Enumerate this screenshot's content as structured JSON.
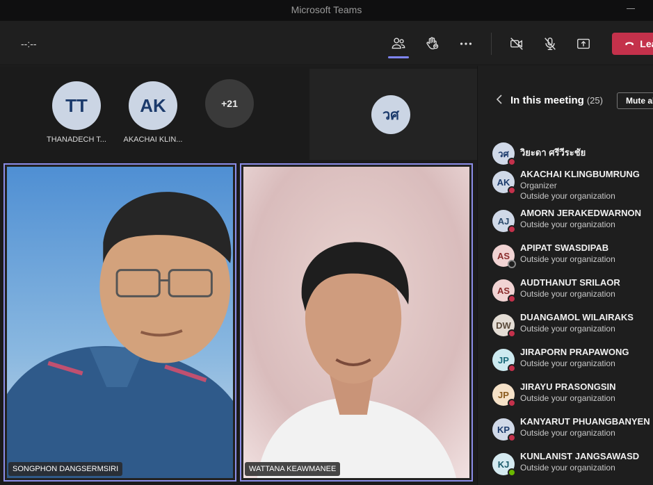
{
  "window": {
    "title": "Microsoft Teams"
  },
  "toolbar": {
    "timer": "--:--",
    "leave_label": "Leave",
    "icons": [
      "people-icon",
      "raise-hand-icon",
      "more-icon",
      "camera-off-icon",
      "mic-off-icon",
      "share-icon",
      "phone-icon"
    ]
  },
  "strip": {
    "avatars": [
      {
        "initials": "TT",
        "name": "THANADECH T..."
      },
      {
        "initials": "AK",
        "name": "AKACHAI KLIN..."
      }
    ],
    "more_count": "+21",
    "pinned_initials": "วศ"
  },
  "videos": [
    {
      "name": "SONGPHON DANGSERMSIRI"
    },
    {
      "name": "WATTANA KEAWMANEE"
    }
  ],
  "panel": {
    "title": "In this meeting",
    "count": "(25)",
    "mute_all_label": "Mute all",
    "participants": [
      {
        "initials": "วศ",
        "name": "วิยะดา ศรีวีระชัย",
        "subs": [],
        "status": "muted",
        "bg": "#d0d9e8",
        "fg": "#1b3a6b"
      },
      {
        "initials": "AK",
        "name": "AKACHAI KLINGBUMRUNG",
        "subs": [
          "Organizer",
          "Outside your organization"
        ],
        "status": "muted",
        "bg": "#d0d9e8",
        "fg": "#1b3a6b"
      },
      {
        "initials": "AJ",
        "name": "AMORN JERAKEDWARNON",
        "subs": [
          "Outside your organization"
        ],
        "status": "muted",
        "bg": "#d0d9e8",
        "fg": "#2c4a6b"
      },
      {
        "initials": "AS",
        "name": "APIPAT SWASDIPAB",
        "subs": [
          "Outside your organization"
        ],
        "status": "offline",
        "bg": "#f1d3d3",
        "fg": "#8a2c2c"
      },
      {
        "initials": "AS",
        "name": "AUDTHANUT SRILAOR",
        "subs": [
          "Outside your organization"
        ],
        "status": "muted",
        "bg": "#f1d3d3",
        "fg": "#8a2c2c"
      },
      {
        "initials": "DW",
        "name": "DUANGAMOL WILAIRAKS",
        "subs": [
          "Outside your organization"
        ],
        "status": "muted",
        "bg": "#e4ddd5",
        "fg": "#5a4a3a"
      },
      {
        "initials": "JP",
        "name": "JIRAPORN PRAPAWONG",
        "subs": [
          "Outside your organization"
        ],
        "status": "muted",
        "bg": "#cdeaf0",
        "fg": "#1a6a7a"
      },
      {
        "initials": "JP",
        "name": "JIRAYU PRASONGSIN",
        "subs": [
          "Outside your organization"
        ],
        "status": "muted",
        "bg": "#f6e2c8",
        "fg": "#8a5a1c"
      },
      {
        "initials": "KP",
        "name": "KANYARUT PHUANGBANYEN",
        "subs": [
          "Outside your organization"
        ],
        "status": "muted",
        "bg": "#d0d9e8",
        "fg": "#1b3a6b"
      },
      {
        "initials": "KJ",
        "name": "KUNLANIST JANGSAWASD",
        "subs": [
          "Outside your organization"
        ],
        "status": "available",
        "bg": "#d5eaf0",
        "fg": "#1a5a6a"
      }
    ]
  },
  "colors": {
    "accent": "#7f85f5",
    "leave": "#c4314b",
    "muted": "#c4314b",
    "available": "#6bb700"
  }
}
